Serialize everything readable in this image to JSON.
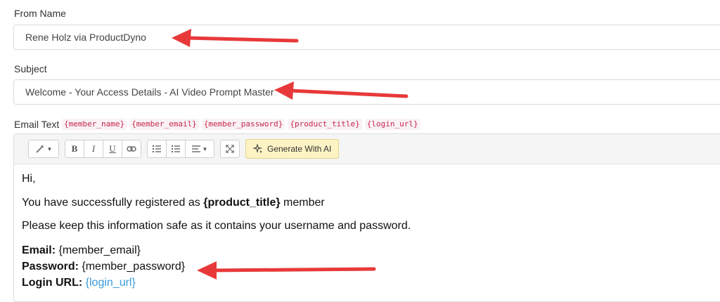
{
  "from_name": {
    "label": "From Name",
    "value": "Rene Holz via ProductDyno"
  },
  "subject": {
    "label": "Subject",
    "value": "Welcome - Your Access Details - AI Video Prompt Master"
  },
  "email_text": {
    "label": "Email Text",
    "tags": [
      "{member_name}",
      "{member_email}",
      "{member_password}",
      "{product_title}",
      "{login_url}"
    ]
  },
  "toolbar": {
    "magic_icon": "magic-wand-icon",
    "bold": "B",
    "italic": "I",
    "underline": "U",
    "ai_button_label": "Generate With AI"
  },
  "body": {
    "greeting": "Hi,",
    "registered_prefix": "You have successfully registered as",
    "registered_tag": "{product_title}",
    "registered_suffix": "member",
    "info": "Please keep this information safe as it contains your username and password.",
    "email_label": "Email:",
    "email_value": "{member_email}",
    "password_label": "Password:",
    "password_value": "{member_password}",
    "login_label": "Login URL:",
    "login_value": "{login_url}"
  },
  "colors": {
    "arrow": "#e8393a",
    "link": "#3a9ad9",
    "tag_text": "#c7254e",
    "ai_button_bg": "#fdf3c4"
  }
}
